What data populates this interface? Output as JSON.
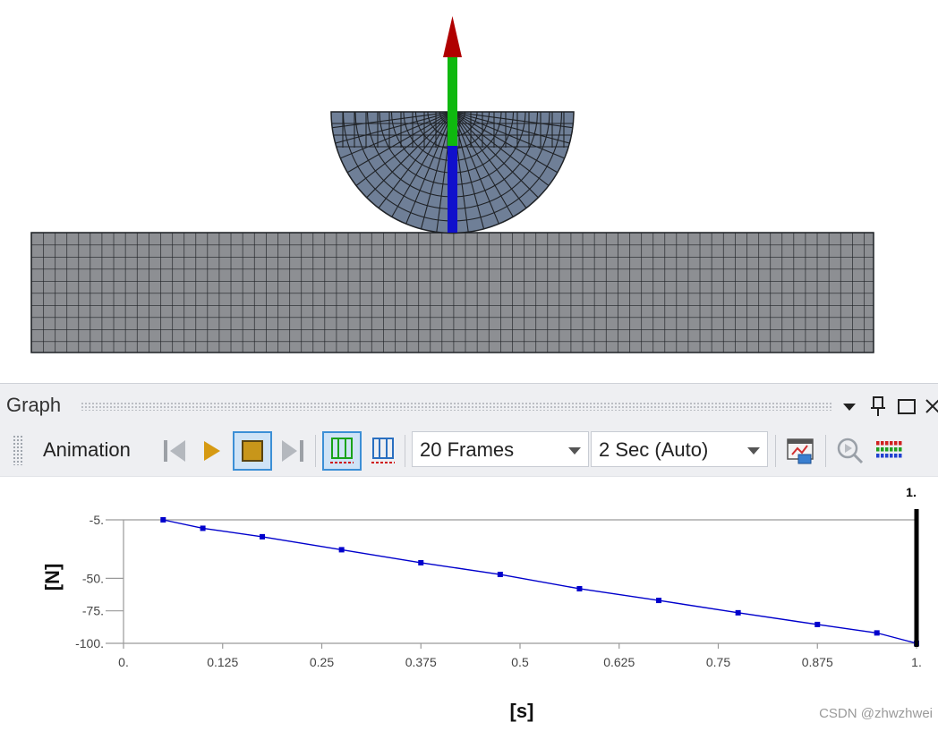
{
  "panel": {
    "title": "Graph",
    "menu_icon": "dropdown-arrow-icon",
    "pin_icon": "pin-icon",
    "maximize_icon": "maximize-icon",
    "close_icon": "close-icon"
  },
  "toolbar": {
    "animation_label": "Animation",
    "buttons": [
      "previous-frame-icon",
      "play-icon",
      "stop-icon",
      "next-frame-icon",
      "distributed-frames-icon",
      "result-frames-icon",
      "export-video-icon",
      "zoom-icon",
      "color-legend-icon"
    ],
    "frames_select": {
      "value": "20 Frames"
    },
    "duration_select": {
      "value": "2 Sec (Auto)"
    },
    "colors": {
      "play": "#d69a13",
      "stop_fill": "#c8961a",
      "active_border": "#3c8fd6"
    }
  },
  "chart_data": {
    "type": "line",
    "xlabel": "[s]",
    "ylabel": "[N]",
    "x_ticks": [
      "0.",
      "0.125",
      "0.25",
      "0.375",
      "0.5",
      "0.625",
      "0.75",
      "0.875",
      "1."
    ],
    "y_ticks": [
      "-5.",
      "-50.",
      "-75.",
      "-100."
    ],
    "xlim": [
      0,
      1
    ],
    "ylim": [
      -100,
      -5
    ],
    "current_time_label": "1.",
    "current_time": 1.0,
    "series": [
      {
        "color": "#0000cc",
        "x": [
          0.05,
          0.1,
          0.175,
          0.275,
          0.375,
          0.475,
          0.575,
          0.675,
          0.775,
          0.875,
          0.95,
          1.0
        ],
        "y": [
          -5,
          -11.5,
          -18,
          -28,
          -38,
          -47,
          -58,
          -67,
          -76.5,
          -85.5,
          -92,
          -100
        ]
      }
    ]
  },
  "watermark": "CSDN @zhwzhwei"
}
